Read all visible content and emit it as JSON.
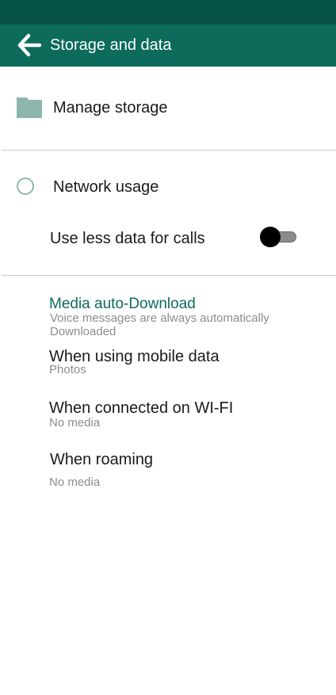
{
  "app_bar": {
    "title": "Storage and data",
    "back_icon": "arrow-left-icon",
    "color": "#0c6b5a",
    "status_bar_color": "#075446"
  },
  "manage_storage": {
    "label": "Manage storage",
    "icon": "folder-icon"
  },
  "network_usage": {
    "label": "Network usage",
    "icon": "circle-icon"
  },
  "use_less_data": {
    "label": "Use less data for calls",
    "enabled": false
  },
  "media_auto_download": {
    "title": "Media auto-Download",
    "description": "Voice messages are always automatically Downloaded",
    "accent": "#0c6b5a",
    "items": [
      {
        "title": "When using mobile data",
        "subtitle": "Photos"
      },
      {
        "title": "When connected on WI-FI",
        "subtitle": "No media"
      },
      {
        "title": "When roaming",
        "subtitle": "No media"
      }
    ]
  }
}
